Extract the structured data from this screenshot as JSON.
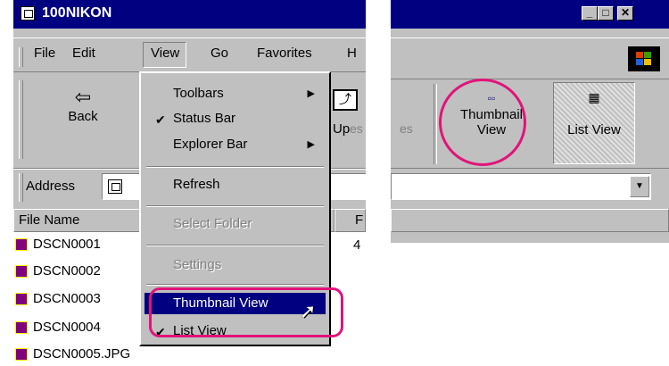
{
  "window": {
    "title": "100NIKON",
    "min": "_",
    "max": "□",
    "close": "✕"
  },
  "menubar": [
    "File",
    "Edit",
    "View",
    "Go",
    "Favorites",
    "H"
  ],
  "toolbar_left": {
    "back": "Back",
    "up": "Up",
    "partial": "es"
  },
  "toolbar_right": {
    "thumbnail_line1": "Thumbnail",
    "thumbnail_line2": "View",
    "list_view": "List View"
  },
  "address": {
    "label": "Address"
  },
  "columns": {
    "file_name": "File Name",
    "second": "F"
  },
  "files": [
    "DSCN0001",
    "DSCN0002",
    "DSCN0003",
    "DSCN0004",
    "DSCN0005.JPG"
  ],
  "partial_size": "4",
  "view_menu": {
    "toolbars": "Toolbars",
    "status_bar": "Status Bar",
    "explorer_bar": "Explorer Bar",
    "refresh": "Refresh",
    "select_folder": "Select Folder",
    "settings": "Settings",
    "thumbnail_view": "Thumbnail View",
    "list_view": "List View"
  },
  "colors": {
    "highlight": "#e0147a",
    "titlebar": "#000080",
    "face": "#c0c0c0"
  }
}
